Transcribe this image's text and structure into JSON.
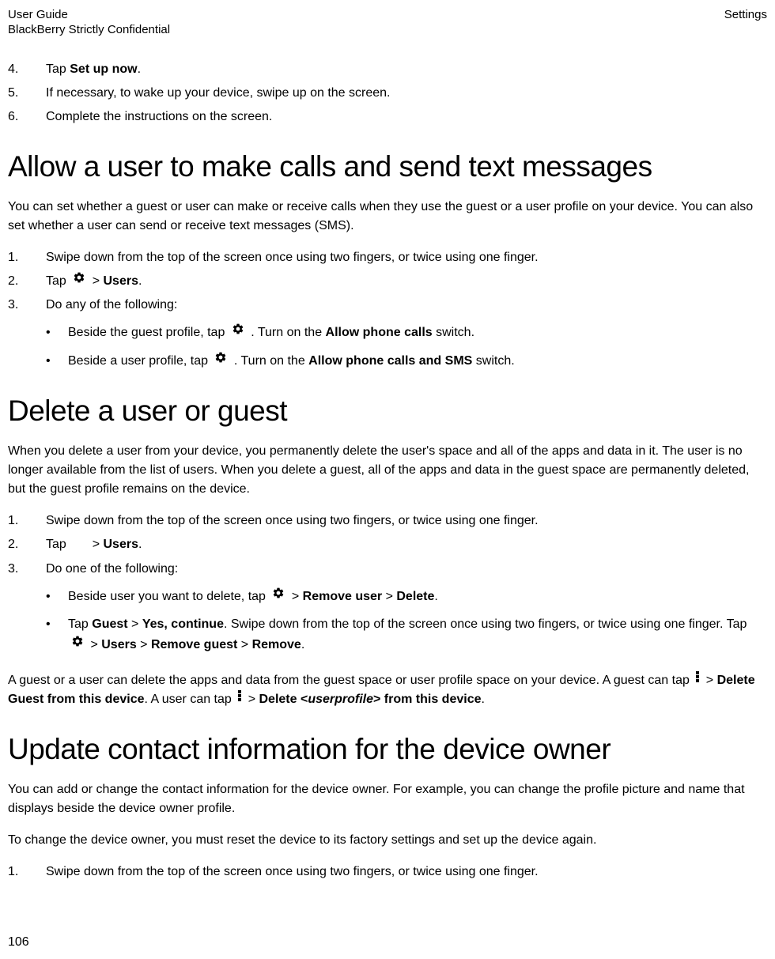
{
  "header": {
    "title": "User Guide",
    "confidential": "BlackBerry Strictly Confidential",
    "section": "Settings"
  },
  "continuedList": {
    "items": [
      {
        "num": "4.",
        "pre": "Tap ",
        "bold": "Set up now",
        "post": "."
      },
      {
        "num": "5.",
        "text": "If necessary, to wake up your device, swipe up on the screen."
      },
      {
        "num": "6.",
        "text": "Complete the instructions on the screen."
      }
    ]
  },
  "section1": {
    "heading": "Allow a user to make calls and send text messages",
    "intro": "You can set whether a guest or user can make or receive calls when they use the guest or a user profile on your device. You can also set whether a user can send or receive text messages (SMS).",
    "steps": [
      {
        "num": "1.",
        "text": "Swipe down from the top of the screen once using two fingers, or twice using one finger."
      },
      {
        "num": "2.",
        "tap_users": true
      },
      {
        "num": "3.",
        "text": "Do any of the following:"
      }
    ],
    "bullets": [
      {
        "pre": "Beside the guest profile, tap ",
        "gear": true,
        "mid": " . Turn on the ",
        "bold": "Allow phone calls",
        "post": " switch."
      },
      {
        "pre": "Beside a user profile, tap ",
        "gear": true,
        "mid": " . Turn on the ",
        "bold": "Allow phone calls and SMS",
        "post": " switch."
      }
    ]
  },
  "section2": {
    "heading": "Delete a user or guest",
    "intro": "When you delete a user from your device, you permanently delete the user's space and all of the apps and data in it. The user is no longer available from the list of users. When you delete a guest, all of the apps and data in the guest space are permanently deleted, but the guest profile remains on the device.",
    "steps": [
      {
        "num": "1.",
        "text": "Swipe down from the top of the screen once using two fingers, or twice using one finger."
      },
      {
        "num": "2.",
        "tap_users": true
      },
      {
        "num": "3.",
        "text": "Do one of the following:"
      }
    ],
    "bullets": [
      {
        "b1_pre": "Beside user you want to delete, tap ",
        "b1_a": "Remove user",
        "b1_b": "Delete"
      },
      {
        "b2_pre": "Tap ",
        "b2_guest": "Guest",
        "b2_yes": "Yes, continue",
        "b2_mid": ". Swipe down from the top of the screen once using two fingers, or twice using one finger. Tap ",
        "b2_users": "Users",
        "b2_remove": "Remove guest",
        "b2_remove2": "Remove"
      }
    ],
    "outro_pre": "A guest or a user can delete the apps and data from the guest space or user profile space on your device. A guest can tap ",
    "outro_a": "Delete Guest from this device",
    "outro_mid": ". A user can tap ",
    "outro_b_pre": "Delete <",
    "outro_b_em": "userprofile",
    "outro_b_post": "> from this device",
    "outro_end": "."
  },
  "section3": {
    "heading": "Update contact information for the device owner",
    "p1": "You can add or change the contact information for the device owner. For example, you can change the profile picture and name that displays beside the device owner profile.",
    "p2": "To change the device owner, you must reset the device to its factory settings and set up the device again.",
    "steps": [
      {
        "num": "1.",
        "text": "Swipe down from the top of the screen once using two fingers, or twice using one finger."
      }
    ]
  },
  "common": {
    "tap": "Tap ",
    "gt": " > ",
    "users": "Users",
    "period": "."
  },
  "pageNumber": "106"
}
